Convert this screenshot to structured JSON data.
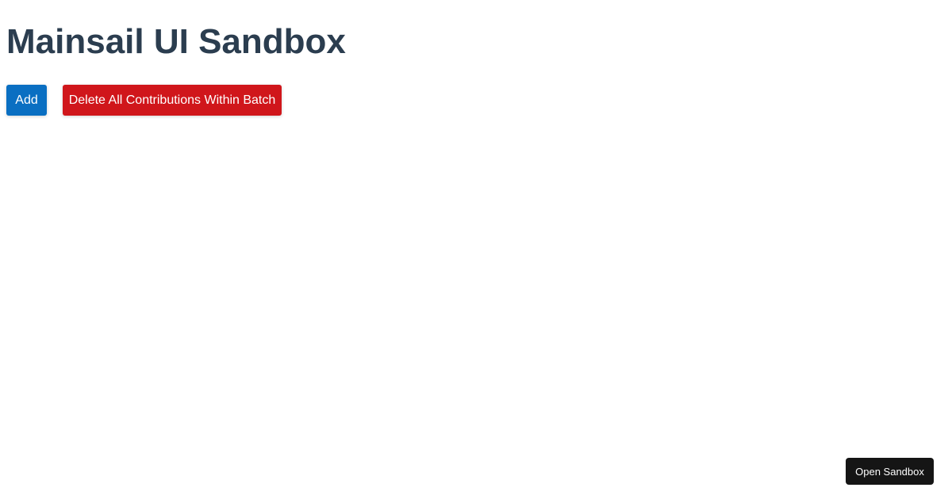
{
  "header": {
    "title": "Mainsail UI Sandbox"
  },
  "actions": {
    "add_label": "Add",
    "delete_label": "Delete All Contributions Within Batch"
  },
  "footer": {
    "open_sandbox_label": "Open Sandbox"
  },
  "colors": {
    "title": "#2b3d4f",
    "add_button": "#0a6fc2",
    "delete_button": "#d0161b",
    "sandbox_button": "#151515"
  }
}
